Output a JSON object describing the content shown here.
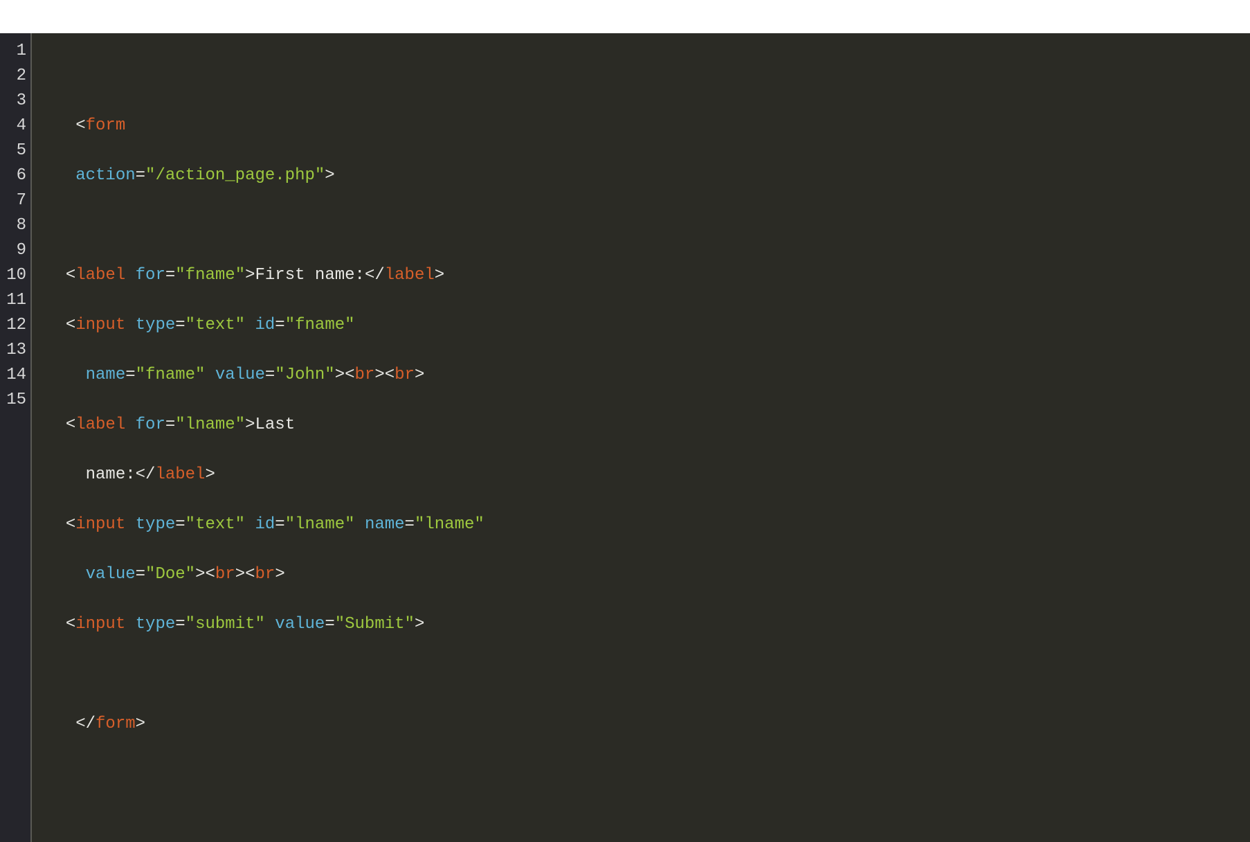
{
  "gutter": [
    "1",
    "2",
    "3",
    "4",
    "5",
    "6",
    "7",
    "8",
    "9",
    "10",
    "11",
    "12",
    "13",
    "14",
    "15"
  ],
  "code": {
    "l1": "",
    "l2_ind": "   ",
    "l2_b1": "<",
    "l2_tag": "form",
    "l3_ind": "   ",
    "l3_attr": "action",
    "l3_eq": "=",
    "l3_q1": "\"",
    "l3_val": "/action_page.php",
    "l3_q2": "\"",
    "l3_gt": ">",
    "l4": "",
    "l5_ind": "  ",
    "l5_b1": "<",
    "l5_tag": "label",
    "l5_sp": " ",
    "l5_attr": "for",
    "l5_eq": "=",
    "l5_q1": "\"",
    "l5_val": "fname",
    "l5_q2": "\"",
    "l5_gt": ">",
    "l5_txt": "First name:",
    "l5_b2": "</",
    "l5_tag2": "label",
    "l5_gt2": ">",
    "l6_ind": "  ",
    "l6_b1": "<",
    "l6_tag": "input",
    "l6_sp": " ",
    "l6_attr1": "type",
    "l6_eq1": "=",
    "l6_q1": "\"",
    "l6_val1": "text",
    "l6_q2": "\"",
    "l6_sp2": " ",
    "l6_attr2": "id",
    "l6_eq2": "=",
    "l6_q3": "\"",
    "l6_val2": "fname",
    "l6_q4": "\"",
    "l7_ind": "    ",
    "l7_attr1": "name",
    "l7_eq1": "=",
    "l7_q1": "\"",
    "l7_val1": "fname",
    "l7_q2": "\"",
    "l7_sp": " ",
    "l7_attr2": "value",
    "l7_eq2": "=",
    "l7_q3": "\"",
    "l7_val2": "John",
    "l7_q4": "\"",
    "l7_gt": ">",
    "l7_br1a": "<",
    "l7_br1t": "br",
    "l7_br1b": ">",
    "l7_br2a": "<",
    "l7_br2t": "br",
    "l7_br2b": ">",
    "l8_ind": "  ",
    "l8_b1": "<",
    "l8_tag": "label",
    "l8_sp": " ",
    "l8_attr": "for",
    "l8_eq": "=",
    "l8_q1": "\"",
    "l8_val": "lname",
    "l8_q2": "\"",
    "l8_gt": ">",
    "l8_txt": "Last",
    "l9_ind": "    ",
    "l9_txt": "name:",
    "l9_b2": "</",
    "l9_tag2": "label",
    "l9_gt2": ">",
    "l10_ind": "  ",
    "l10_b1": "<",
    "l10_tag": "input",
    "l10_sp": " ",
    "l10_attr1": "type",
    "l10_eq1": "=",
    "l10_q1": "\"",
    "l10_val1": "text",
    "l10_q2": "\"",
    "l10_sp2": " ",
    "l10_attr2": "id",
    "l10_eq2": "=",
    "l10_q3": "\"",
    "l10_val2": "lname",
    "l10_q4": "\"",
    "l10_sp3": " ",
    "l10_attr3": "name",
    "l10_eq3": "=",
    "l10_q5": "\"",
    "l10_val3": "lname",
    "l10_q6": "\"",
    "l11_ind": "    ",
    "l11_attr": "value",
    "l11_eq": "=",
    "l11_q1": "\"",
    "l11_val": "Doe",
    "l11_q2": "\"",
    "l11_gt": ">",
    "l11_br1a": "<",
    "l11_br1t": "br",
    "l11_br1b": ">",
    "l11_br2a": "<",
    "l11_br2t": "br",
    "l11_br2b": ">",
    "l12_ind": "  ",
    "l12_b1": "<",
    "l12_tag": "input",
    "l12_sp": " ",
    "l12_attr1": "type",
    "l12_eq1": "=",
    "l12_q1": "\"",
    "l12_val1": "submit",
    "l12_q2": "\"",
    "l12_sp2": " ",
    "l12_attr2": "value",
    "l12_eq2": "=",
    "l12_q3": "\"",
    "l12_val2": "Submit",
    "l12_q4": "\"",
    "l12_gt": ">",
    "l13": "",
    "l14_ind": "   ",
    "l14_b2": "</",
    "l14_tag2": "form",
    "l14_gt2": ">",
    "l15": ""
  }
}
